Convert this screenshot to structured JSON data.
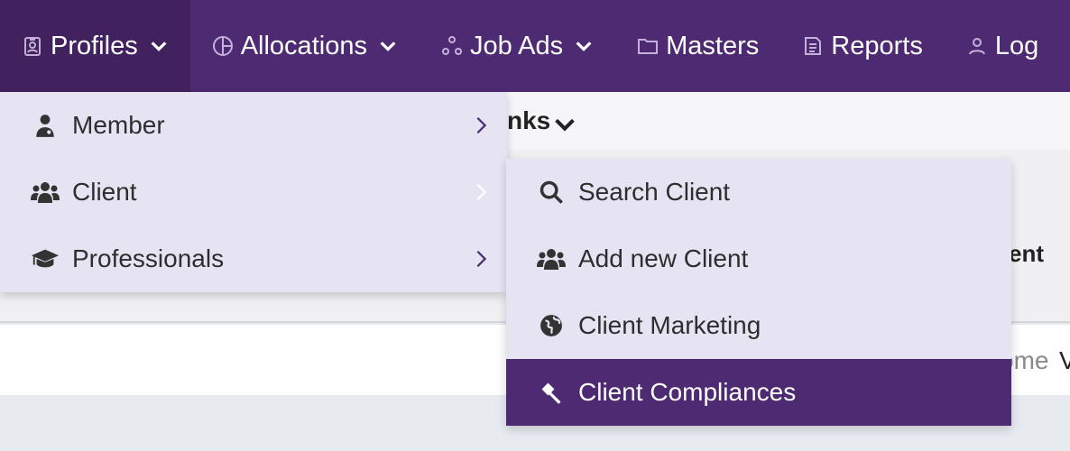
{
  "nav": {
    "items": [
      {
        "label": "Profiles",
        "icon": "id-badge-icon",
        "has_dropdown": true,
        "active": true
      },
      {
        "label": "Allocations",
        "icon": "pie-chart-icon",
        "has_dropdown": true
      },
      {
        "label": "Job Ads",
        "icon": "network-icon",
        "has_dropdown": true
      },
      {
        "label": "Masters",
        "icon": "folder-icon",
        "has_dropdown": false
      },
      {
        "label": "Reports",
        "icon": "document-icon",
        "has_dropdown": false
      },
      {
        "label": "Log",
        "icon": "user-icon",
        "has_dropdown": false
      }
    ]
  },
  "background": {
    "subbar_text": "nks",
    "panel_text": "ent",
    "whitebar_text": "ome",
    "whitebar_text2": "V"
  },
  "profiles_menu": {
    "items": [
      {
        "label": "Member",
        "icon": "doctor-icon"
      },
      {
        "label": "Client",
        "icon": "users-icon"
      },
      {
        "label": "Professionals",
        "icon": "graduation-cap-icon"
      }
    ]
  },
  "client_menu": {
    "items": [
      {
        "label": "Search Client",
        "icon": "search-icon"
      },
      {
        "label": "Add new Client",
        "icon": "users-icon"
      },
      {
        "label": "Client Marketing",
        "icon": "globe-icon"
      },
      {
        "label": "Client Compliances",
        "icon": "gavel-icon",
        "selected": true
      }
    ]
  },
  "colors": {
    "brand": "#4e2a72",
    "menu_bg": "#e6e4f3",
    "selected_text": "#ffffff"
  }
}
